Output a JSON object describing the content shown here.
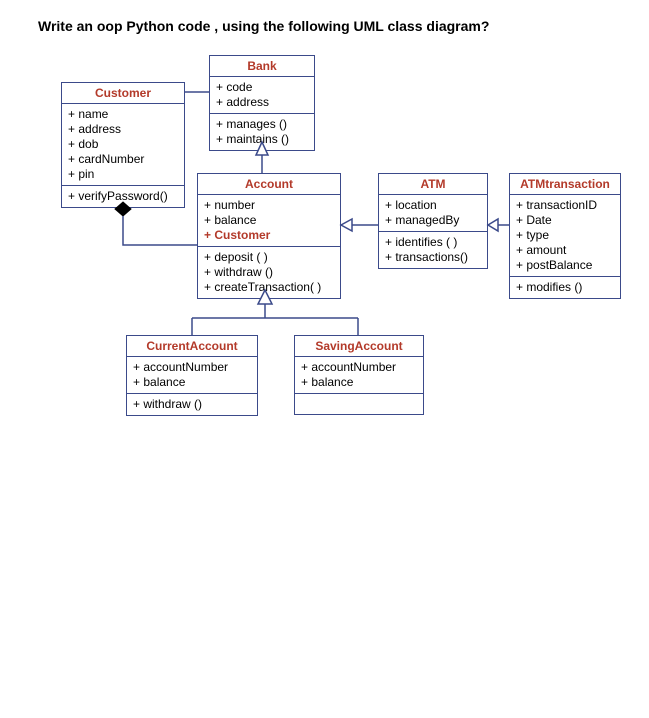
{
  "question": "Write an oop Python code ,  using the following UML class diagram?",
  "classes": {
    "bank": {
      "name": "Bank",
      "attrs": [
        "+ code",
        "+ address"
      ],
      "ops": [
        "+ manages ()",
        "+ maintains ()"
      ]
    },
    "customer": {
      "name": "Customer",
      "attrs": [
        "+ name",
        "+ address",
        "+ dob",
        "+ cardNumber",
        "+ pin"
      ],
      "ops": [
        "+ verifyPassword()"
      ]
    },
    "account": {
      "name": "Account",
      "attrs": [
        "+ number",
        "+ balance",
        "+ Customer"
      ],
      "ops": [
        "+ deposit ( )",
        "+ withdraw ()",
        "+ createTransaction( )"
      ]
    },
    "atm": {
      "name": "ATM",
      "attrs": [
        "+ location",
        "+ managedBy"
      ],
      "ops": [
        "+ identifies ( )",
        "+ transactions()"
      ]
    },
    "atmtransaction": {
      "name": "ATMtransaction",
      "attrs": [
        "+ transactionID",
        "+ Date",
        "+ type",
        "+ amount",
        "+ postBalance"
      ],
      "ops": [
        "+ modifies ()"
      ]
    },
    "currentaccount": {
      "name": "CurrentAccount",
      "attrs": [
        "+ accountNumber",
        "+ balance"
      ],
      "ops": [
        "+ withdraw ()"
      ]
    },
    "savingaccount": {
      "name": "SavingAccount",
      "attrs": [
        "+ accountNumber",
        "+ balance"
      ],
      "ops": []
    }
  }
}
